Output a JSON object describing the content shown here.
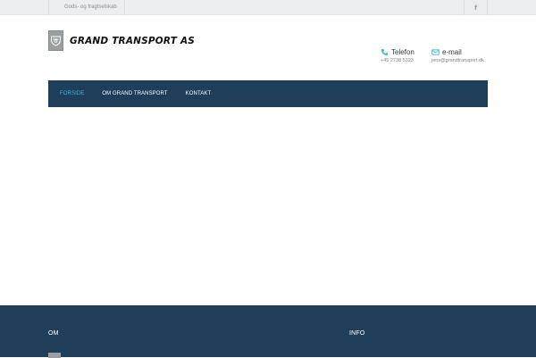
{
  "topbar": {
    "tagline": "Gods- og fragtselskab",
    "social_icon": "facebook-icon"
  },
  "brand": {
    "name": "GRAND TRANSPORT AS",
    "logo_icon": "shield-logo-icon"
  },
  "contact": {
    "phone_label": "Telefon",
    "phone_value": "+45 2738 5323",
    "email_label": "e-mail",
    "email_value": "jens@grandtransport.dk"
  },
  "nav": {
    "items": [
      {
        "label": "FORSIDE",
        "active": true
      },
      {
        "label": "OM GRAND TRANSPORT",
        "active": false
      },
      {
        "label": "KONTAKT",
        "active": false
      }
    ]
  },
  "footer": {
    "col1_title": "OM",
    "col2_title": "INFO"
  },
  "colors": {
    "navy": "#1f3e5a",
    "accent": "#3fb6e8",
    "topbar_bg": "#eceeef"
  }
}
